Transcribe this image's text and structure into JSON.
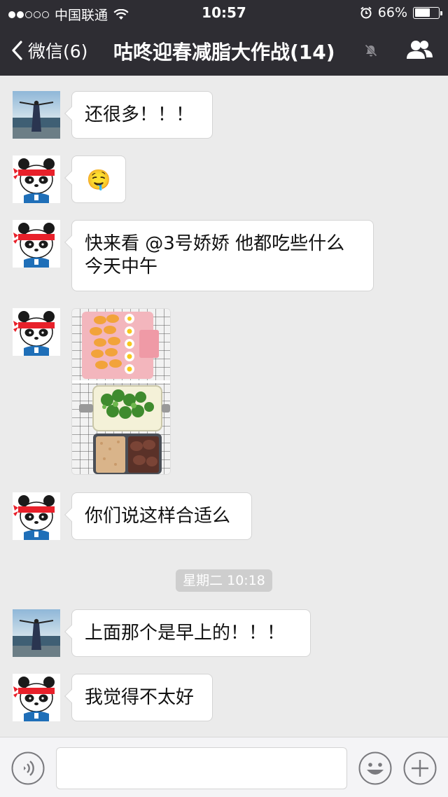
{
  "status_bar": {
    "carrier": "中国联通",
    "time": "10:57",
    "battery": "66%",
    "battery_level": 0.66
  },
  "nav": {
    "back_label": "微信(6)",
    "title": "咕咚迎春减脂大作战(14)"
  },
  "messages": [
    {
      "sender": "beach-avatar",
      "type": "text",
      "text": "还很多！！！"
    },
    {
      "sender": "panda-avatar",
      "type": "emoji",
      "emoji": "🤤"
    },
    {
      "sender": "panda-avatar",
      "type": "text",
      "lines": [
        "快来看 @3号娇娇 他都吃些什么",
        "今天中午"
      ]
    },
    {
      "sender": "panda-avatar",
      "type": "image",
      "image": "lunch-photo"
    },
    {
      "sender": "panda-avatar",
      "type": "text",
      "text": "你们说这样合适么"
    },
    {
      "type": "timestamp",
      "text": "星期二 10:18"
    },
    {
      "sender": "beach-avatar",
      "type": "text",
      "text": "上面那个是早上的！！！"
    },
    {
      "sender": "panda-avatar",
      "type": "text",
      "text": "我觉得不太好"
    }
  ],
  "input": {
    "value": ""
  },
  "colors": {
    "header_bg": "#2e2d33",
    "chat_bg": "#ebebeb",
    "bubble_bg": "#ffffff"
  }
}
